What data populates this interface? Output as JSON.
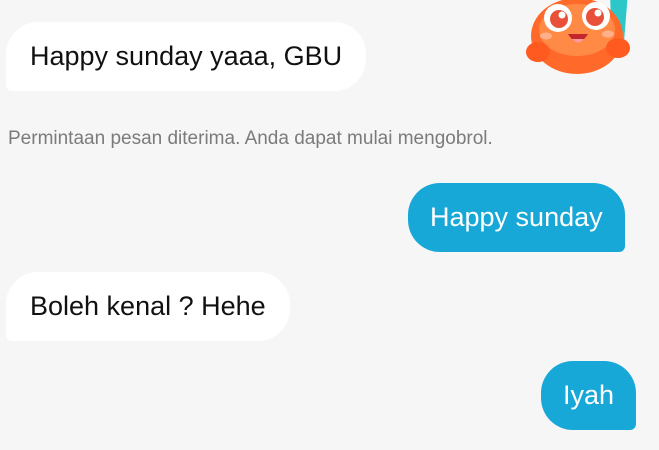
{
  "messages": [
    {
      "text": "Happy sunday yaaa, GBU",
      "direction": "incoming"
    },
    {
      "text": "Happy sunday",
      "direction": "outgoing"
    },
    {
      "text": "Boleh kenal ? Hehe",
      "direction": "incoming"
    },
    {
      "text": "Iyah",
      "direction": "outgoing"
    }
  ],
  "system_notice": "Permintaan pesan diterima. Anda dapat mulai mengobrol.",
  "sticker": {
    "icon": "orange-creature-sticker-icon"
  },
  "colors": {
    "background": "#f6f6f6",
    "incoming_bubble": "#ffffff",
    "outgoing_bubble": "#17a8d8",
    "notice_text": "#7b7b7b"
  }
}
